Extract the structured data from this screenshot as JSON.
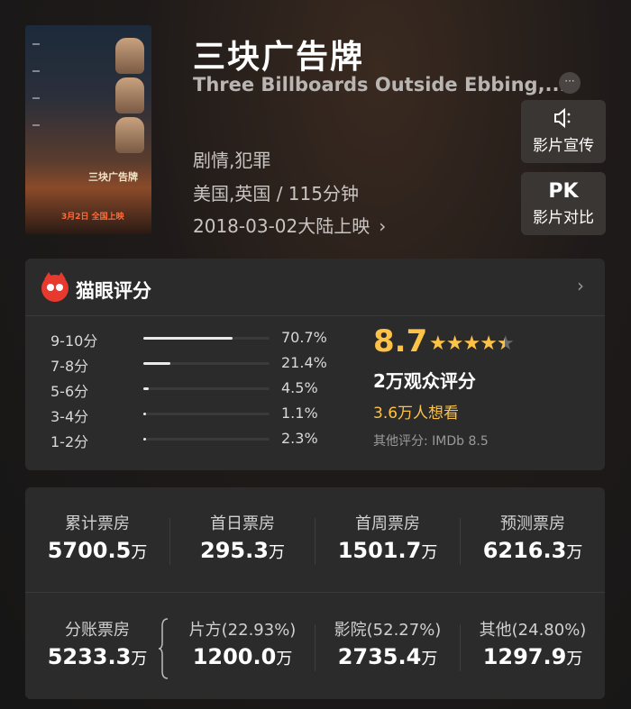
{
  "movie": {
    "title": "三块广告牌",
    "en_title": "Three Billboards Outside Ebbing,...",
    "more": "···",
    "genre": "剧情,犯罪",
    "region_duration": "美国,英国 / 115分钟",
    "release": "2018-03-02大陆上映",
    "release_chevron": "›",
    "poster": {
      "title": "三块广告牌",
      "date": "3月2日 全国上映"
    }
  },
  "actions": [
    {
      "icon": "speaker-icon",
      "glyph": "🔈",
      "label": "影片宣传"
    },
    {
      "icon": "pk-icon",
      "glyph": "PK",
      "label": "影片对比"
    }
  ],
  "rating": {
    "header": "猫眼评分",
    "chevron": "›",
    "distribution": [
      {
        "label": "9-10分",
        "pct": "70.7%",
        "value": 70.7
      },
      {
        "label": "7-8分",
        "pct": "21.4%",
        "value": 21.4
      },
      {
        "label": "5-6分",
        "pct": "4.5%",
        "value": 4.5
      },
      {
        "label": "3-4分",
        "pct": "1.1%",
        "value": 1.1
      },
      {
        "label": "1-2分",
        "pct": "2.3%",
        "value": 2.3
      }
    ],
    "score": "8.7",
    "stars": 4.5,
    "votes": "2万观众评分",
    "wish": "3.6万人想看",
    "other": "其他评分: IMDb 8.5",
    "accent": "#fec247"
  },
  "box_office": {
    "row1": [
      {
        "label": "累计票房",
        "value": "5700.5",
        "unit": "万"
      },
      {
        "label": "首日票房",
        "value": "295.3",
        "unit": "万"
      },
      {
        "label": "首周票房",
        "value": "1501.7",
        "unit": "万"
      },
      {
        "label": "预测票房",
        "value": "6216.3",
        "unit": "万"
      }
    ],
    "row2": [
      {
        "label": "分账票房",
        "value": "5233.3",
        "unit": "万"
      },
      {
        "label": "片方(22.93%)",
        "value": "1200.0",
        "unit": "万"
      },
      {
        "label": "影院(52.27%)",
        "value": "2735.4",
        "unit": "万"
      },
      {
        "label": "其他(24.80%)",
        "value": "1297.9",
        "unit": "万"
      }
    ]
  }
}
